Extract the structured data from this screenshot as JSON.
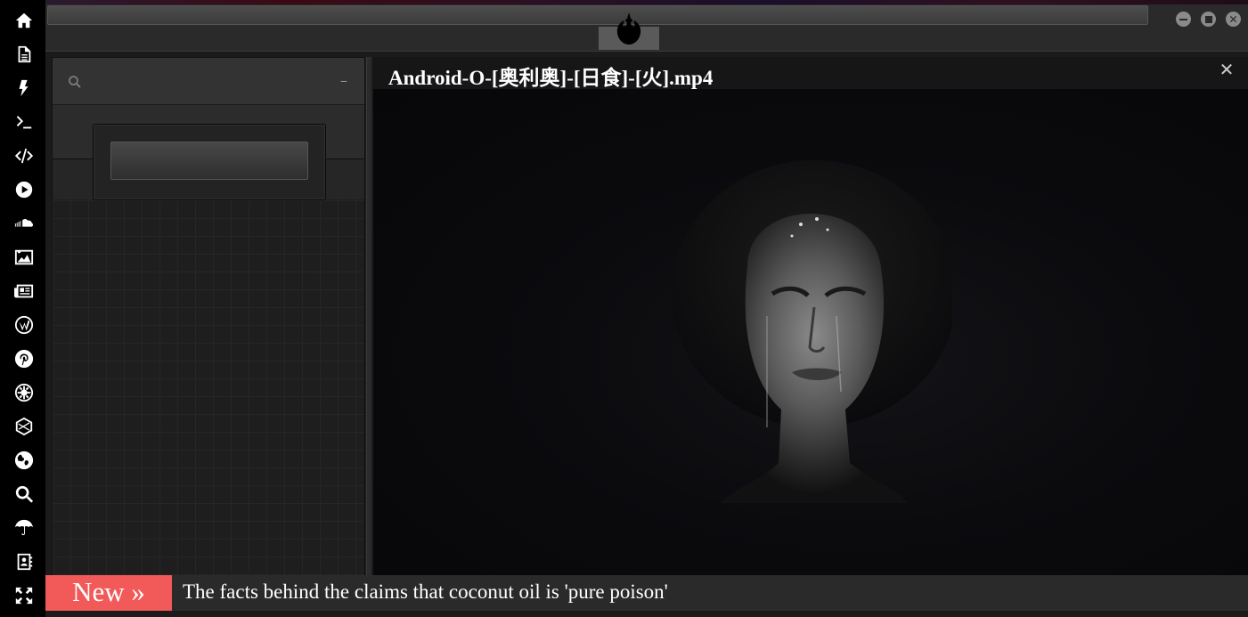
{
  "rail": {
    "icons": [
      "home-icon",
      "document-icon",
      "bolt-icon",
      "terminal-icon",
      "code-icon",
      "play-icon",
      "soundcloud-icon",
      "image-icon",
      "newspaper-icon",
      "wordpress-icon",
      "pinterest-icon",
      "galactic-empire-icon",
      "hexagon-icon",
      "globe-icon",
      "search-icon",
      "umbrella-icon",
      "contact-book-icon",
      "expand-icon"
    ]
  },
  "topbar": {
    "url_value": "",
    "logo": "rebel-alliance-icon"
  },
  "window_controls": {
    "minimize": "minimize-icon",
    "maximize": "maximize-icon",
    "close": "close-icon"
  },
  "left_panel": {
    "search_icon": "search-icon",
    "collapse_label": "−",
    "button_label": ""
  },
  "video_window": {
    "title": "Android-O-[奥利奥]-[日食]-[火].mp4",
    "close_label": "✕"
  },
  "ticker": {
    "badge": "New »",
    "headline": "The facts behind the claims that coconut oil is 'pure poison'"
  },
  "colors": {
    "accent": "#f25a5a",
    "rail": "#000000",
    "panel": "#1e1e1e"
  }
}
